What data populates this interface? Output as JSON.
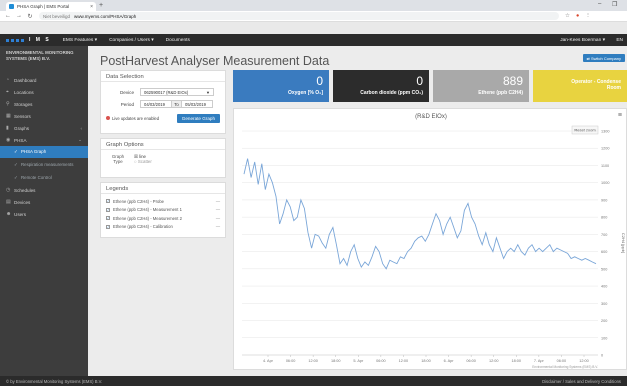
{
  "browser": {
    "tab_title": "PHSA Graph | EMS Portal",
    "tab_close": "×",
    "new_tab": "+",
    "secure_label": "Niet beveiligd",
    "url": "www.myems.com/PHSA/Graph",
    "window_controls": [
      "–",
      "❐"
    ]
  },
  "topnav": {
    "logo_text": "I M S",
    "items": [
      "EMS Features ▾",
      "Companies / Users ▾",
      "Documents"
    ],
    "user": "Jan-Kees Boerman ▾",
    "lang": "EN"
  },
  "sidebar": {
    "brand": "ENVIRONMENTAL MONITORING SYSTEMS (EMS) B.V.",
    "items": [
      {
        "label": "Dashboard",
        "icon": "◔"
      },
      {
        "label": "Locations",
        "icon": "⌖"
      },
      {
        "label": "Storages",
        "icon": "⚲"
      },
      {
        "label": "Sensors",
        "icon": "▦"
      },
      {
        "label": "Graphs",
        "icon": "▮",
        "chevron": "‹"
      },
      {
        "label": "PHSA",
        "icon": "◉",
        "chevron": "⌄"
      }
    ],
    "sub_items": [
      {
        "label": "PHSA Graph",
        "icon": "✓"
      },
      {
        "label": "Respiration measurements",
        "icon": "✓"
      },
      {
        "label": "Remote Control",
        "icon": "✓"
      }
    ],
    "bottom_items": [
      {
        "label": "Schedules",
        "icon": "◷"
      },
      {
        "label": "Devices",
        "icon": "▤"
      },
      {
        "label": "Users",
        "icon": "☻"
      }
    ]
  },
  "main": {
    "title": "PostHarvest Analyser Measurement Data",
    "switch_company": "⇄ Switch Company"
  },
  "data_selection": {
    "title": "Data Selection",
    "device_label": "Device",
    "device_value": "062590017 (R&D EIOx)",
    "period_label": "Period",
    "from": "04/03/2019",
    "to_label": "To",
    "to": "05/03/2019",
    "live_text": "Live updates are enabled",
    "generate": "Generate Graph"
  },
  "graph_options": {
    "title": "Graph Options",
    "label_line1": "Graph",
    "label_line2": "Type",
    "opt_line": "☒ line",
    "opt_scatter": "○ Scatter"
  },
  "legend": {
    "title": "Legends",
    "items": [
      "Ethene (ppb C2H4) - Probe",
      "Ethene (ppb C2H4) - Measurement 1",
      "Ethene (ppb C2H4) - Measurement 2",
      "Ethene (ppb C2H4) - Calibration"
    ],
    "check": "✓",
    "dash": "—"
  },
  "tiles": [
    {
      "value": "0",
      "label": "Oxygen [% O₂]",
      "color": "#3a7bbf"
    },
    {
      "value": "0",
      "label": "Carbon dioxide (ppm CO₂)",
      "color": "#2c2c2c"
    },
    {
      "value": "889",
      "label": "Ethene (ppb C2H4)",
      "color": "#a9a9a9"
    },
    {
      "value": "Operator - Condense",
      "label": "Room",
      "color": "#e8d340"
    }
  ],
  "chart_data": {
    "type": "line",
    "title": "(R&D EIOx)",
    "ylabel": "C2H4 [ppb]",
    "ylim": [
      0,
      1300
    ],
    "yticks": [
      "0",
      "100",
      "200",
      "300",
      "400",
      "500",
      "600",
      "700",
      "800",
      "900",
      "1000",
      "1100",
      "1200",
      "1300"
    ],
    "xticks": [
      "4. Apr",
      "06:00",
      "12:00",
      "18:00",
      "5. Apr",
      "06:00",
      "12:00",
      "18:00",
      "6. Apr",
      "06:00",
      "12:00",
      "18:00",
      "7. Apr",
      "06:00",
      "12:00"
    ],
    "reset_zoom": "Reset zoom",
    "credit": "Environmental Monitoring Systems (EMS) B.V.",
    "series": [
      {
        "color": "#7aa6d8",
        "values": [
          1050,
          1140,
          1030,
          1120,
          990,
          1110,
          960,
          1050,
          1000,
          920,
          760,
          820,
          900,
          860,
          780,
          800,
          900,
          850,
          710,
          620,
          700,
          690,
          650,
          620,
          700,
          740,
          640,
          530,
          560,
          520,
          600,
          640,
          560,
          510,
          540,
          520,
          570,
          630,
          600,
          530,
          500,
          550,
          540,
          530,
          570,
          560,
          600,
          620,
          660,
          680,
          690,
          660,
          700,
          760,
          820,
          780,
          700,
          760,
          800,
          740,
          680,
          720,
          840,
          880,
          800,
          760,
          690,
          640,
          710,
          640,
          600,
          680,
          620,
          560,
          600,
          620,
          600,
          640,
          600,
          580,
          620,
          640,
          600,
          620,
          600,
          620,
          640,
          600,
          620,
          610,
          600,
          590,
          560,
          570,
          560,
          550,
          560,
          550,
          540,
          530
        ]
      }
    ]
  },
  "footer": {
    "left": "© by Environmental Monitoring Systems (EMS) B.V.",
    "right": "Disclaimer / Sales and Delivery Conditions"
  },
  "colors": {
    "accent": "#2f7dbf",
    "sidebar": "#3d3d3d",
    "topbar": "#2b2b2b"
  }
}
